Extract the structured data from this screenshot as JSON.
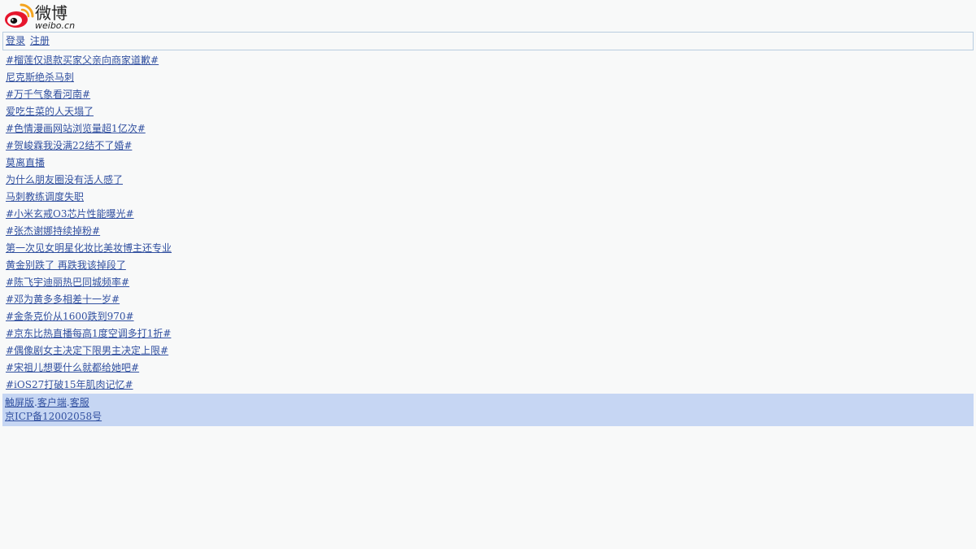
{
  "logo": {
    "chinese": "微博",
    "domain": "weibo.cn"
  },
  "auth": {
    "login": "登录",
    "register": "注册"
  },
  "topics": [
    "#榴莲仅退款买家父亲向商家道歉#",
    "尼克斯绝杀马刺",
    "#万千气象看河南#",
    "爱吃生菜的人天塌了",
    "#色情漫画网站浏览量超1亿次#",
    "#贺峻霖我没满22结不了婚#",
    "莫离直播",
    "为什么朋友圈没有活人感了",
    "马刺教练调度失职",
    "#小米玄戒O3芯片性能曝光#",
    "#张杰谢娜持续掉粉#",
    "第一次见女明星化妆比美妆博主还专业",
    "黄金别跌了 再跌我该掉段了",
    "#陈飞宇迪丽热巴同城频率#",
    "#邓为黄多多相差十一岁#",
    "#金条克价从1600跌到970#",
    "#京东比热直播每高1度空调多打1折#",
    "#偶像剧女主决定下限男主决定上限#",
    "#宋祖儿想要什么就都给她吧#",
    "#iOS27打破15年肌肉记忆#"
  ],
  "footer": {
    "touch": "触屏版",
    "client": "客户端",
    "service": "客服",
    "separator": ".",
    "icp": "京ICP备12002058号"
  },
  "colors": {
    "link": "#3150a0",
    "background": "#f8f9f9",
    "footer_bg": "#c6d6f3",
    "border": "#b9cde0",
    "logo_red": "#e6162d",
    "logo_orange": "#f4a41f"
  }
}
